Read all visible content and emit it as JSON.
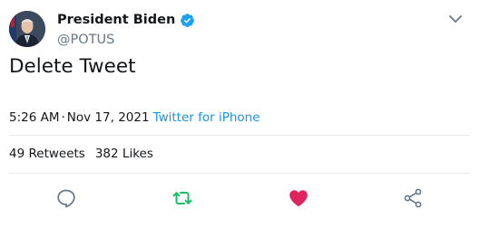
{
  "author": {
    "display_name": "President Biden",
    "handle": "@POTUS",
    "verified": true
  },
  "tweet": {
    "text": "Delete Tweet",
    "time": "5:26 AM",
    "separator": "·",
    "date": "Nov 17, 2021",
    "source": "Twitter for iPhone"
  },
  "stats": {
    "retweets_count": "49",
    "retweets_label": "Retweets",
    "likes_count": "382",
    "likes_label": "Likes"
  },
  "actions": {
    "reply_icon": "speech-bubble-icon",
    "retweet_icon": "retweet-icon",
    "like_icon": "heart-icon",
    "share_icon": "share-icon"
  },
  "colors": {
    "accent_blue": "#1b95e0",
    "verified_blue": "#1da1f2",
    "retweet_green": "#17bf63",
    "like_red": "#e0245e",
    "icon_gray": "#657786",
    "divider": "#e6ecf0"
  }
}
